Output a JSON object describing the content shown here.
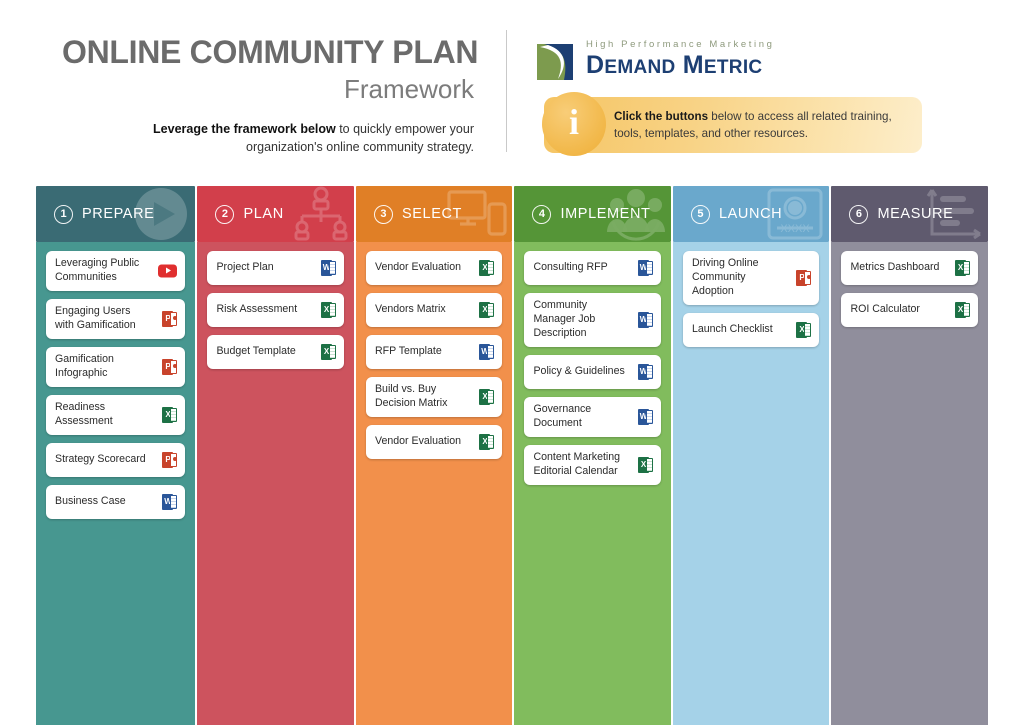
{
  "header": {
    "title_main": "ONLINE COMMUNITY PLAN",
    "title_sub": "Framework",
    "tagline_bold": "Leverage the framework below",
    "tagline_rest": " to quickly empower your organization's online community strategy."
  },
  "logo": {
    "tagline": "High Performance Marketing",
    "name_part1": "D",
    "name_part2": "EMAND",
    "name_part3": "M",
    "name_part4": "ETRIC",
    "mark_green": "#7d9b4e",
    "mark_navy": "#1d3f73"
  },
  "callout": {
    "icon": "info-icon",
    "bold": "Click the buttons",
    "rest": " below to access all related training, tools, templates, and other resources."
  },
  "columns": [
    {
      "number": "1",
      "label": "PREPARE",
      "head_color": "#3a6b74",
      "body_color": "#479790",
      "art": "play-button-icon",
      "cards": [
        {
          "label": "Leveraging Public Communities",
          "icon": "youtube-icon"
        },
        {
          "label": "Engaging Users with Gamification",
          "icon": "powerpoint-icon"
        },
        {
          "label": "Gamification Infographic",
          "icon": "powerpoint-icon"
        },
        {
          "label": "Readiness Assessment",
          "icon": "excel-icon"
        },
        {
          "label": "Strategy Scorecard",
          "icon": "powerpoint-icon"
        },
        {
          "label": "Business Case",
          "icon": "word-icon"
        }
      ]
    },
    {
      "number": "2",
      "label": "PLAN",
      "head_color": "#d23f4b",
      "body_color": "#cd535e",
      "art": "org-chart-icon",
      "cards": [
        {
          "label": "Project Plan",
          "icon": "word-icon"
        },
        {
          "label": "Risk Assessment",
          "icon": "excel-icon"
        },
        {
          "label": "Budget Template",
          "icon": "excel-icon"
        }
      ]
    },
    {
      "number": "3",
      "label": "SELECT",
      "head_color": "#e07f26",
      "body_color": "#f2904b",
      "art": "devices-icon",
      "cards": [
        {
          "label": "Vendor Evaluation",
          "icon": "excel-icon"
        },
        {
          "label": "Vendors Matrix",
          "icon": "excel-icon"
        },
        {
          "label": "RFP Template",
          "icon": "word-icon"
        },
        {
          "label": "Build vs. Buy Decision Matrix",
          "icon": "excel-icon"
        },
        {
          "label": "Vendor Evaluation",
          "icon": "excel-icon"
        }
      ]
    },
    {
      "number": "4",
      "label": "IMPLEMENT",
      "head_color": "#559537",
      "body_color": "#81bc5d",
      "art": "people-group-icon",
      "cards": [
        {
          "label": "Consulting RFP",
          "icon": "word-icon"
        },
        {
          "label": "Community Manager Job Description",
          "icon": "word-icon"
        },
        {
          "label": "Policy & Guidelines",
          "icon": "word-icon"
        },
        {
          "label": "Governance Document",
          "icon": "word-icon"
        },
        {
          "label": "Content Marketing Editorial Calendar",
          "icon": "excel-icon"
        }
      ]
    },
    {
      "number": "5",
      "label": "LAUNCH",
      "head_color": "#6aa8cc",
      "body_color": "#a5d2e8",
      "art": "id-badge-icon",
      "cards": [
        {
          "label": "Driving Online Community Adoption",
          "icon": "powerpoint-icon"
        },
        {
          "label": "Launch Checklist",
          "icon": "excel-icon"
        }
      ]
    },
    {
      "number": "6",
      "label": "MEASURE",
      "head_color": "#5f5a6e",
      "body_color": "#908e9c",
      "art": "bar-chart-icon",
      "cards": [
        {
          "label": "Metrics Dashboard",
          "icon": "excel-icon"
        },
        {
          "label": "ROI Calculator",
          "icon": "excel-icon"
        }
      ]
    }
  ]
}
